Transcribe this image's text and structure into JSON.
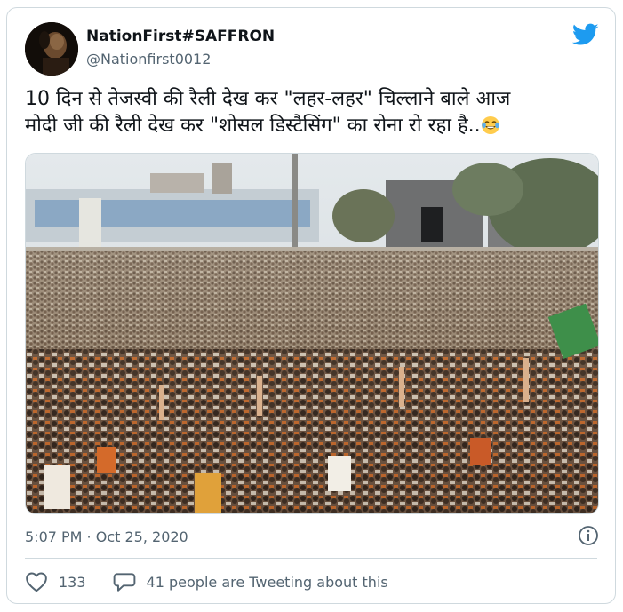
{
  "tweet": {
    "author": {
      "display_name": "NationFirst#SAFFRON",
      "handle": "@Nationfirst0012"
    },
    "text_lines": [
      "10 दिन से तेजस्वी की रैली देख कर \"लहर-लहर\" चिल्लाने बाले आज",
      "मोदी जी की रैली देख कर \"शोसल डिस्टैसिंग\" का रोना रो रहा है.."
    ],
    "emoji": "face-with-tears-of-joy-icon",
    "media": {
      "type": "photo",
      "subject": "large crowd at rally"
    },
    "timestamp": "5:07 PM · Oct 25, 2020",
    "likes_count": "133",
    "reply_text": "41 people are Tweeting about this"
  },
  "colors": {
    "brand": "#1d9bf0",
    "text_primary": "#0f1419",
    "text_secondary": "#536471",
    "border": "#cfd9de"
  },
  "icons": {
    "logo": "twitter-bird-icon",
    "info": "info-icon",
    "like": "heart-icon",
    "reply": "speech-bubble-icon"
  }
}
